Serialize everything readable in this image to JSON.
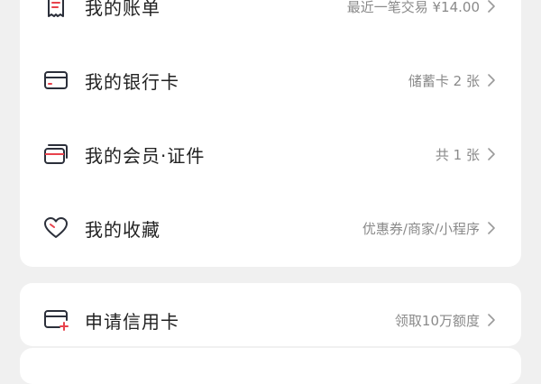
{
  "menu": {
    "items": [
      {
        "label": "我的账单",
        "value": "最近一笔交易 ¥14.00",
        "icon": "receipt-icon"
      },
      {
        "label": "我的银行卡",
        "value": "储蓄卡 2 张",
        "icon": "bank-card-icon"
      },
      {
        "label": "我的会员·证件",
        "value": "共 1 张",
        "icon": "member-cards-icon"
      },
      {
        "label": "我的收藏",
        "value": "优惠券/商家/小程序",
        "icon": "heart-icon"
      }
    ]
  },
  "credit": {
    "label": "申请信用卡",
    "value": "领取10万额度",
    "icon": "credit-card-add-icon"
  },
  "colors": {
    "icon_stroke": "#2b2f3a",
    "accent": "#e8424c",
    "text_primary": "#222222",
    "text_secondary": "#8a8a8a",
    "background": "#f0f0f0",
    "card": "#ffffff"
  }
}
